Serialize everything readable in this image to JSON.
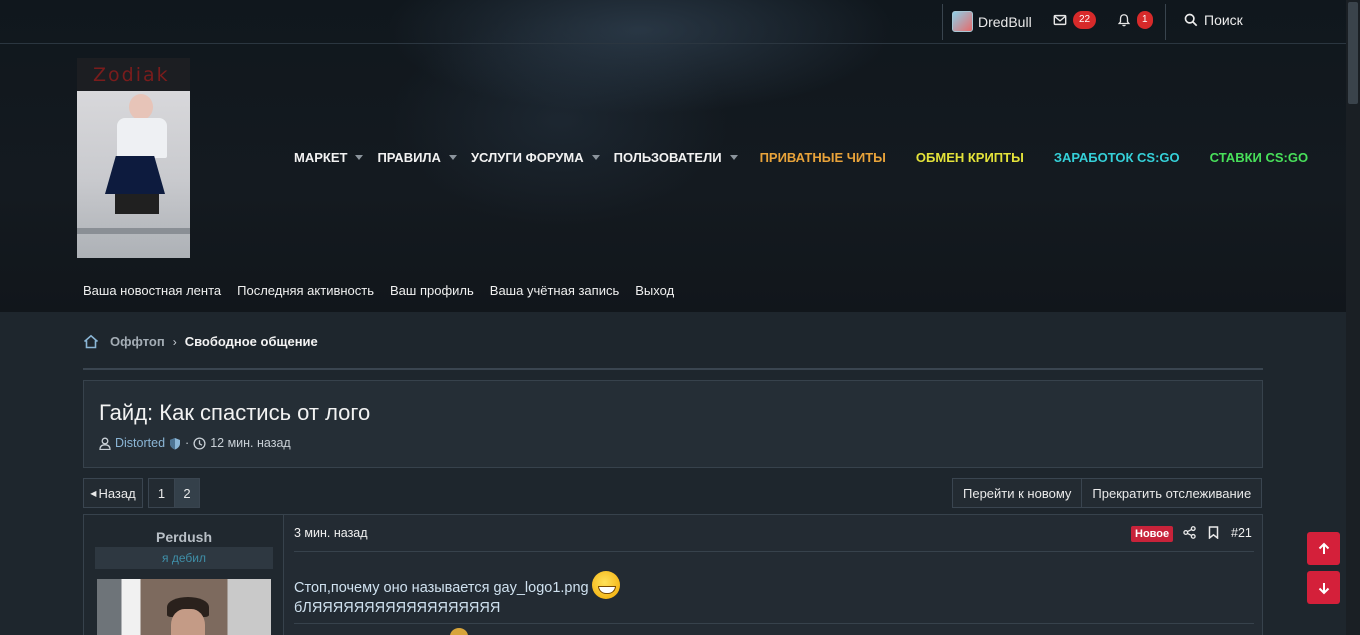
{
  "topbar": {
    "username": "DredBull",
    "messages_count": "22",
    "alerts_count": "1",
    "search_label": "Поиск"
  },
  "logo": {
    "text": "Zodiak"
  },
  "main_nav": [
    {
      "label": "МАРКЕТ",
      "color": "#f2f2f2",
      "has_dropdown": true
    },
    {
      "label": "ПРАВИЛА",
      "color": "#f2f2f2",
      "has_dropdown": true
    },
    {
      "label": "УСЛУГИ ФОРУМА",
      "color": "#f2f2f2",
      "has_dropdown": true
    },
    {
      "label": "ПОЛЬЗОВАТЕЛИ",
      "color": "#f2f2f2",
      "has_dropdown": true
    },
    {
      "label": "ПРИВАТНЫЕ ЧИТЫ",
      "color": "#e8a33a",
      "has_dropdown": false
    },
    {
      "label": "ОБМЕН КРИПТЫ",
      "color": "#e4e33a",
      "has_dropdown": false
    },
    {
      "label": "ЗАРАБОТОК CS:GO",
      "color": "#35d0d8",
      "has_dropdown": false
    },
    {
      "label": "СТАВКИ CS:GO",
      "color": "#48e05a",
      "has_dropdown": false
    }
  ],
  "sub_nav": [
    "Ваша новостная лента",
    "Последняя активность",
    "Ваш профиль",
    "Ваша учётная запись",
    "Выход"
  ],
  "breadcrumb": {
    "parent": "Оффтоп",
    "current": "Свободное общение"
  },
  "thread": {
    "title": "Гайд: Как спастись от лого",
    "author": "Distorted",
    "separator": "·",
    "time": "12 мин. назад"
  },
  "pagination": {
    "back": "Назад",
    "pages": [
      "1",
      "2"
    ],
    "current": "2"
  },
  "thread_actions": {
    "goto_new": "Перейти к новому",
    "unwatch": "Прекратить отслеживание"
  },
  "post": {
    "username": "Perdush",
    "user_title": "я дебил",
    "time": "3 мин. назад",
    "new_label": "Новое",
    "number": "#21",
    "line1": "Стоп,почему оно называется gay_logo1.png",
    "line2": "бЛЯЯЯЯЯЯЯЯЯЯЯЯЯЯЯЯЯЯ"
  },
  "colors": {
    "accent_red": "#d4203a",
    "link_blue": "#8bb6d6"
  }
}
